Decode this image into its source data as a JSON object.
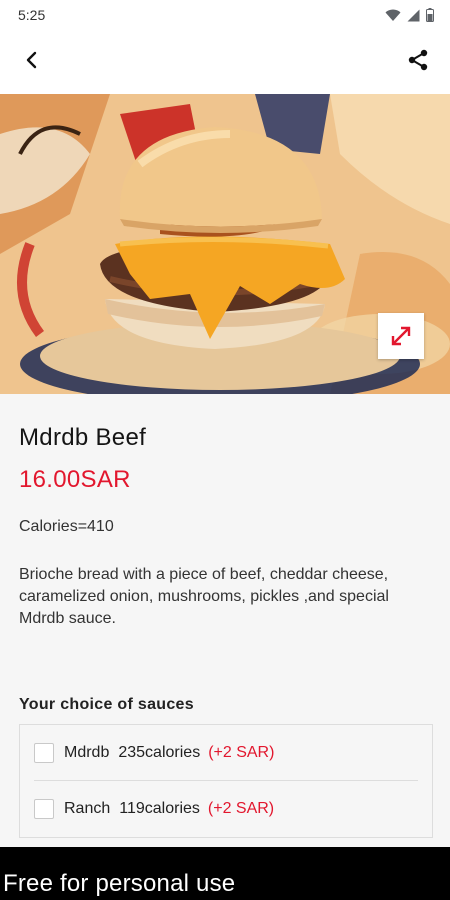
{
  "status_bar": {
    "time": "5:25",
    "icons": [
      "wifi-icon",
      "signal-icon",
      "battery-icon"
    ]
  },
  "app_bar": {
    "back_icon": "chevron-left-icon",
    "share_icon": "share-icon"
  },
  "product": {
    "name": "Mdrdb Beef",
    "price": "16.00SAR",
    "calories": "Calories=410",
    "description": "Brioche bread with a piece of beef, cheddar cheese, caramelized onion, mushrooms, pickles ,and special Mdrdb sauce."
  },
  "sauces": {
    "title": "Your choice of sauces",
    "options": [
      {
        "name": "Mdrdb",
        "calories": "235calories",
        "price": "(+2 SAR)",
        "checked": false
      },
      {
        "name": "Ranch",
        "calories": "119calories",
        "price": "(+2 SAR)",
        "checked": false
      }
    ]
  },
  "banner": {
    "text": "Free for personal use"
  },
  "colors": {
    "accent": "#e2172e",
    "background": "#f6f6f6"
  }
}
